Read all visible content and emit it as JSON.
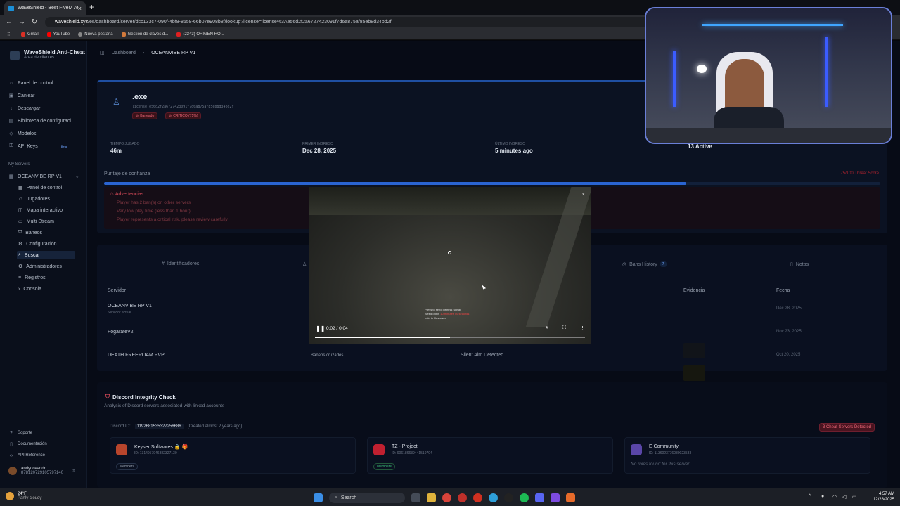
{
  "browser": {
    "tab_title": "WaveShield - Best FiveM Anti-C",
    "url_host": "waveshield.xyz",
    "url_path": "/es/dashboard/server/dcc133c7-090f-4bf8-8558-66b07e908b8f/lookup?license=license%3Ae56d2f2a6727423091f7d6a875af85eb8d34bd2f",
    "bookmarks": [
      "Gmail",
      "YouTube",
      "Nueva pestaña",
      "Gestión de claves d...",
      "(2343) ORIGEN HO..."
    ]
  },
  "sidebar": {
    "brand_title": "WaveShield Anti-Cheat",
    "brand_sub": "Área de clientes",
    "items": [
      {
        "label": "Panel de control",
        "icon": "home-icon"
      },
      {
        "label": "Canjear",
        "icon": "gift-icon"
      },
      {
        "label": "Descargar",
        "icon": "download-icon"
      },
      {
        "label": "Biblioteca de configuraci...",
        "icon": "library-icon"
      },
      {
        "label": "Modelos",
        "icon": "cube-icon"
      },
      {
        "label": "API Keys",
        "icon": "key-icon",
        "badge": "Beta"
      }
    ],
    "section": "My Servers",
    "server_name": "OCEANVIBE RP V1",
    "sub_items": [
      "Panel de control",
      "Jugadores",
      "Mapa interactivo",
      "Multi Stream",
      "Baneos",
      "Configuración",
      "Buscar",
      "Administradores",
      "Registros",
      "Consola"
    ],
    "active_sub": "Buscar",
    "footer": [
      "Soporte",
      "Documentación",
      "API Reference"
    ],
    "user_name": "andyoceandr",
    "user_id": "878120729105797140"
  },
  "topbar": {
    "crumb1": "Dashboard",
    "crumb2": "OCEANVIBE RP V1"
  },
  "player": {
    "name": ".exe",
    "license": "license:e56d2f2a6727423091f7d6a875af85eb8d34bd2f",
    "tag_banned": "Baneado",
    "tag_critical": "CRÍTICO (75%)",
    "stats": [
      {
        "label": "TIEMPO JUGADO",
        "value": "46m"
      },
      {
        "label": "PRIMER INGRESO",
        "value": "Dec 28, 2025"
      },
      {
        "label": "ÚLTIMO INGRESO",
        "value": "5 minutes ago"
      },
      {
        "label": "",
        "value": "13 Active"
      }
    ],
    "trust_label": "Puntaje de confianza",
    "trust_right": "75/100 Threat Score",
    "trust_value": 0.75
  },
  "warnings": {
    "title": "Advertencias",
    "lines": [
      "Player has 2 ban(s) on other servers",
      "Very low play time (less than 1 hour)",
      "Player represents a critical risk, please review carefully"
    ]
  },
  "tabs": {
    "identifiers": "Identificadores",
    "bans_history": "Bans History",
    "bans_count": "7",
    "notes": "Notas"
  },
  "table": {
    "col_server": "Servidor",
    "col_evidence": "Evidencia",
    "col_date": "Fecha",
    "rows": [
      {
        "server": "OCEANVIBE RP V1",
        "sub": "Servidor actual",
        "type": "",
        "reason": "",
        "date": "Dec 28, 2025"
      },
      {
        "server": "FogarateV2",
        "sub": "",
        "type": "",
        "reason": "",
        "date": "Nov 23, 2025"
      },
      {
        "server": "DEATH FREEROAM PVP",
        "sub": "",
        "type": "Baneos cruzados",
        "reason": "Silent Aim Detected",
        "date": "Oct 20, 2025"
      }
    ]
  },
  "discord": {
    "title": "Discord Integrity Check",
    "subtitle": "Analysis of Discord servers associated with linked accounts",
    "id_label": "Discord ID:",
    "id_value": "1192681535327256686",
    "id_note": "(Created almost 2 years ago)",
    "badge": "3 Cheat Servers Detected",
    "servers": [
      {
        "name": "Keyser Softwares 🔒 🎁",
        "id": "ID: 1314957946382327130",
        "role": "Members",
        "color": "#b8452c"
      },
      {
        "name": "TZ - Project",
        "id": "ID: 906186639441519704",
        "role": "Members",
        "color": "#c02030"
      },
      {
        "name": "E Community",
        "id": "ID: 1136023776080023583",
        "role": "No roles found for this server.",
        "color": "#5a46a8"
      }
    ]
  },
  "video": {
    "time": "0:02 / 0:04",
    "progress": 0.5,
    "hint1": "Press",
    "hint1b": "to send distress signal",
    "hint2": "Bleed out in",
    "hint2b": "10 minutes 00 seconds",
    "hint3": "hold",
    "hint3b": "to Respawn"
  },
  "taskbar": {
    "temp": "24°F",
    "weather": "Partly cloudy",
    "search": "Search",
    "time": "4:57 AM",
    "date": "12/28/2025"
  }
}
